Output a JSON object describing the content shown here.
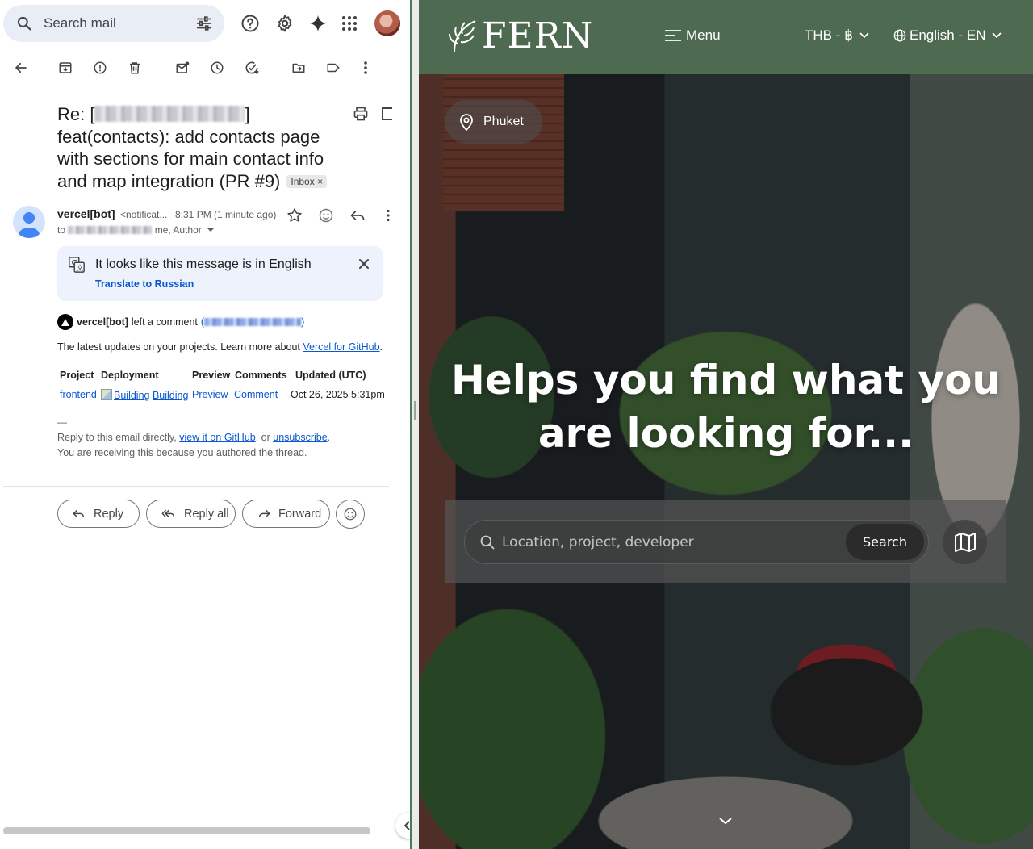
{
  "mail": {
    "search": {
      "placeholder": "Search mail"
    },
    "subject": {
      "prefix": "Re: [",
      "suffix": "]",
      "title": "feat(contacts): add contacts page with sections for main contact info and map integration (PR #9)",
      "label": "Inbox",
      "label_close": "×"
    },
    "sender": {
      "name": "vercel[bot]",
      "email": "<notificat...",
      "time": "8:31 PM (1 minute ago)",
      "to_prefix": "to",
      "to_suffix": "me, Author"
    },
    "translate": {
      "message": "It looks like this message is in English",
      "link": "Translate to Russian"
    },
    "body": {
      "commenter": "vercel[bot]",
      "comment_text": "left a comment",
      "paren_open": "(",
      "paren_close": ")",
      "intro": "The latest updates on your projects. Learn more about",
      "intro_link": "Vercel for GitHub",
      "intro_end": ".",
      "table": {
        "headers": [
          "Project",
          "Deployment",
          "Preview",
          "Comments",
          "Updated (UTC)"
        ],
        "row": {
          "project": "frontend",
          "deployment_img_alt": "Building",
          "deployment": "Building",
          "preview": "Preview",
          "comment": "Comment",
          "updated": "Oct 26, 2025 5:31pm"
        }
      },
      "sig_dash": "—",
      "footer1_pre": "Reply to this email directly,",
      "footer1_link1": "view it on GitHub",
      "footer1_mid": ", or",
      "footer1_link2": "unsubscribe",
      "footer1_end": ".",
      "footer2": "You are receiving this because you authored the thread."
    },
    "actions": {
      "reply": "Reply",
      "reply_all": "Reply all",
      "forward": "Forward"
    }
  },
  "fern": {
    "brand": "FERN",
    "nav": {
      "menu": "Menu",
      "currency": "THB - ฿",
      "language": "English - EN"
    },
    "location": "Phuket",
    "headline_line1": "Helps you find what you",
    "headline_line2": "are looking for...",
    "search": {
      "placeholder": "Location, project, developer",
      "button": "Search"
    }
  },
  "colors": {
    "fern_nav": "#4e6a50",
    "mail_accent": "#0b57d0",
    "search_bg": "#e9eef6",
    "translate_bg": "#edf2fc"
  }
}
